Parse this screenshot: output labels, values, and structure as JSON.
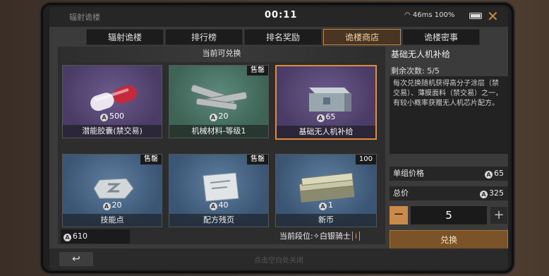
{
  "topbar": {
    "title": "辐射诡楼",
    "timer": "00:11",
    "network": "46ms",
    "battery": "100%",
    "close_icon": "close-icon"
  },
  "tabs": [
    {
      "label": "辐射诡楼",
      "active": false
    },
    {
      "label": "排行榜",
      "active": false
    },
    {
      "label": "排名奖励",
      "active": false
    },
    {
      "label": "诡楼商店",
      "active": true
    },
    {
      "label": "诡楼密事",
      "active": false
    }
  ],
  "shop": {
    "section_title": "当前可兑换",
    "items": [
      {
        "name": "潜能胶囊(禁交易)",
        "price": "500",
        "badge": "",
        "color": "#6c5a8c",
        "icon": "capsule-icon"
      },
      {
        "name": "机械材料-等级1",
        "price": "20",
        "badge": "售罄",
        "color": "#5c8a7c",
        "icon": "metal-bolts-icon"
      },
      {
        "name": "基础无人机补给",
        "price": "65",
        "badge": "",
        "color": "#6c5a8c",
        "icon": "supply-box-icon",
        "selected": true
      },
      {
        "name": "技能点",
        "price": "20",
        "badge": "售罄",
        "color": "#5e7ea0",
        "icon": "skill-token-icon"
      },
      {
        "name": "配方残页",
        "price": "40",
        "badge": "售罄",
        "color": "#5e7ea0",
        "icon": "recipe-page-icon"
      },
      {
        "name": "新币",
        "price": "1",
        "badge": "100",
        "color": "#5e7ea0",
        "icon": "cash-stack-icon"
      }
    ],
    "balance": "610",
    "rank_label": "当前段位:",
    "rank_value": "白银骑士",
    "rank_info": "i"
  },
  "detail": {
    "title": "基础无人机补给",
    "remaining": "剩余次数: 5/5",
    "description": "每次兑换随机获得高分子涂层（禁交易）、薄膜面料（禁交易）之一，有较小概率获赠无人机芯片配方。",
    "unit_price_label": "单组价格",
    "unit_price": "65",
    "total_label": "总价",
    "total": "325",
    "quantity": "5",
    "redeem_label": "兑换"
  },
  "bottom": {
    "back_icon": "back-arrow-icon",
    "hint": "点击空白处关闭"
  }
}
